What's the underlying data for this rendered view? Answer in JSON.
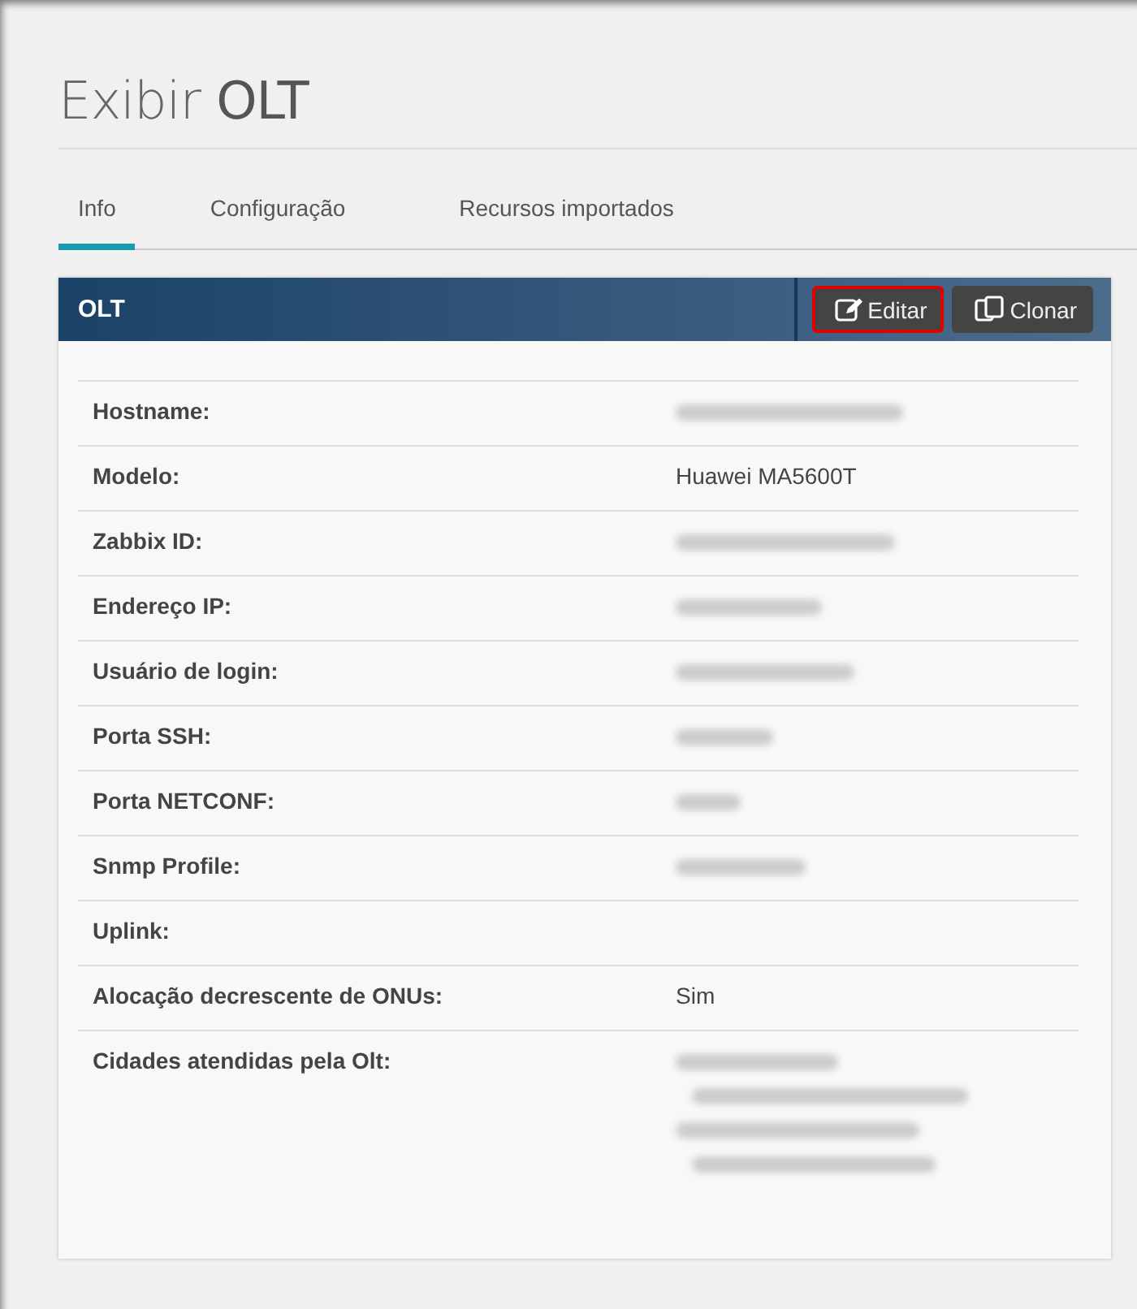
{
  "page_title": {
    "prefix": "Exibir",
    "emphasis": "OLT"
  },
  "tabs": [
    {
      "label": "Info",
      "selected": true
    },
    {
      "label": "Configuração",
      "selected": false
    },
    {
      "label": "Recursos importados",
      "selected": false
    }
  ],
  "panel": {
    "title": "OLT",
    "buttons": [
      {
        "label": "Editar",
        "kind": "edit",
        "highlighted": true
      },
      {
        "label": "Clonar",
        "kind": "clone",
        "highlighted": false
      }
    ],
    "rows": [
      {
        "label": "Hostname:",
        "values": [
          {
            "kind": "blurred"
          }
        ]
      },
      {
        "label": "Modelo:",
        "values": [
          {
            "kind": "text",
            "text": "Huawei MA5600T"
          }
        ]
      },
      {
        "label": "Zabbix ID:",
        "values": [
          {
            "kind": "blurred"
          }
        ]
      },
      {
        "label": "Endereço IP:",
        "values": [
          {
            "kind": "blurred"
          }
        ]
      },
      {
        "label": "Usuário de login:",
        "values": [
          {
            "kind": "blurred"
          }
        ]
      },
      {
        "label": "Porta SSH:",
        "values": [
          {
            "kind": "blurred"
          }
        ]
      },
      {
        "label": "Porta NETCONF:",
        "values": [
          {
            "kind": "blurred"
          }
        ]
      },
      {
        "label": "Snmp Profile:",
        "values": [
          {
            "kind": "blurred"
          }
        ]
      },
      {
        "label": "Uplink:"
      },
      {
        "label": "Alocação decrescente de ONUs:",
        "values": [
          {
            "kind": "text",
            "text": "Sim"
          }
        ]
      },
      {
        "label": "Cidades atendidas pela Olt:",
        "values": [
          {
            "kind": "blurred"
          },
          {
            "kind": "blurred"
          },
          {
            "kind": "blurred"
          },
          {
            "kind": "blurred"
          }
        ]
      }
    ]
  }
}
